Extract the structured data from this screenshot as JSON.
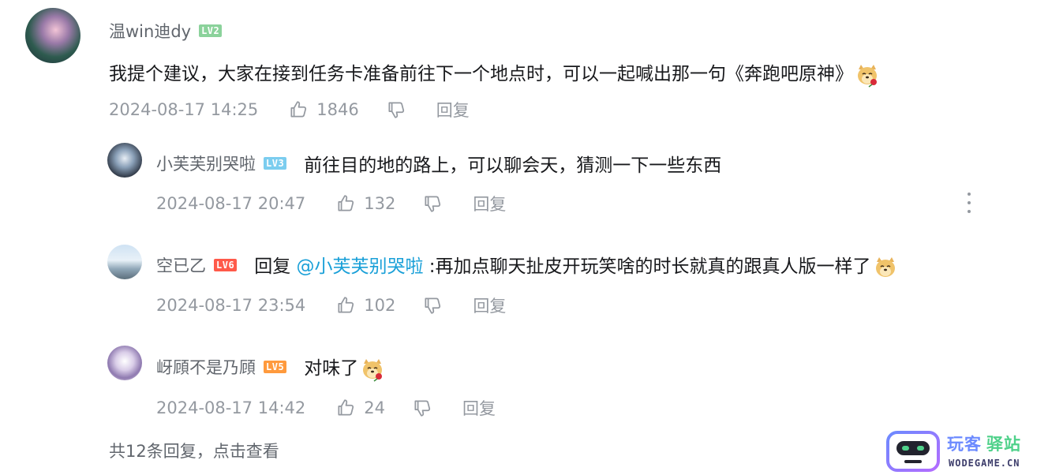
{
  "main_comment": {
    "username": "温win迪dy",
    "level": "LV2",
    "content": "我提个建议，大家在接到任务卡准备前往下一个地点时，可以一起喊出那一句《奔跑吧原神》",
    "emoji_icon": "doge-rose-emoji-icon",
    "time": "2024-08-17 14:25",
    "likes": "1846",
    "reply_label": "回复"
  },
  "replies": [
    {
      "username": "小芙芙别哭啦",
      "level": "LV3",
      "content": "前往目的地的路上，可以聊会天，猜测一下一些东西",
      "time": "2024-08-17 20:47",
      "likes": "132",
      "reply_label": "回复"
    },
    {
      "username": "空已乙",
      "level": "LV6",
      "reply_prefix": "回复 ",
      "mention": "@小芙芙别哭啦",
      "content": " :再加点聊天扯皮开玩笑啥的时长就真的跟真人版一样了",
      "emoji_icon": "doge-emoji-icon",
      "time": "2024-08-17 23:54",
      "likes": "102",
      "reply_label": "回复"
    },
    {
      "username": "岈頋不是乃頋",
      "level": "LV5",
      "content": "对味了",
      "emoji_icon": "doge-rose-emoji-icon",
      "time": "2024-08-17 14:42",
      "likes": "24",
      "reply_label": "回复"
    }
  ],
  "view_all_text": "共12条回复，点击查看",
  "watermark": {
    "title_part1": "玩客",
    "title_part2": "驿站",
    "subtitle": "WODEGAME.CN"
  },
  "colors": {
    "mention": "#1aa0d8",
    "meta_gray": "#9499a0",
    "lv2": "#8bd29b",
    "lv3": "#7bcdef",
    "lv5": "#ff9a3d",
    "lv6": "#ff5a4a"
  }
}
